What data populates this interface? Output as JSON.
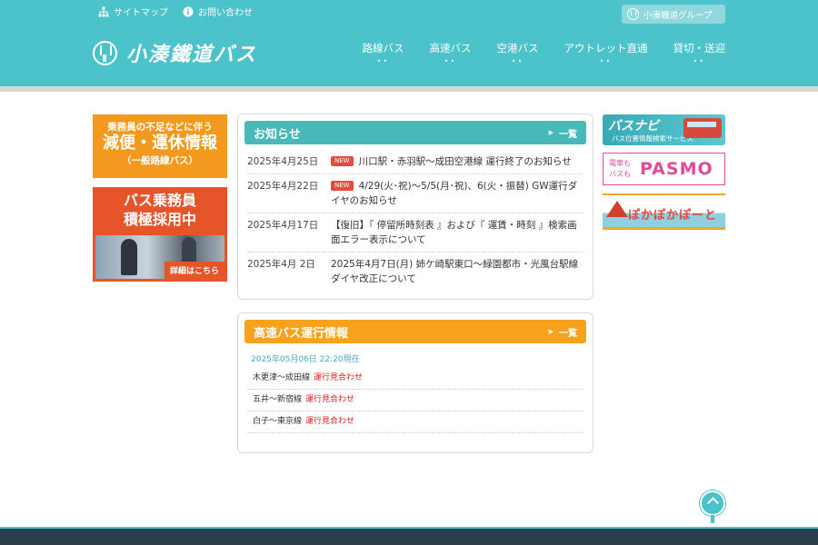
{
  "header": {
    "util_links": [
      {
        "label": "サイトマップ",
        "icon": "sitemap-icon"
      },
      {
        "label": "お問い合わせ",
        "icon": "info-icon"
      }
    ],
    "group_button": "小湊鐵道グループ",
    "logo_text": "小湊鐵道バス",
    "nav": [
      {
        "label": "路線バス"
      },
      {
        "label": "高速バス"
      },
      {
        "label": "空港バス"
      },
      {
        "label": "アウトレット直通"
      },
      {
        "label": "貸切・送迎"
      }
    ]
  },
  "left_banners": {
    "notice": {
      "top": "乗務員の不足などに伴う",
      "main": "減便・運休情報",
      "sub": "（一般路線バス）"
    },
    "recruit": {
      "line1": "バス乗務員",
      "line2": "積極採用中",
      "more": "詳細はこちら"
    }
  },
  "right_banners": {
    "busnavi": {
      "name": "バスナビ",
      "desc": "バス位置情報検索サービス"
    },
    "pasmo": {
      "small1": "電車も",
      "small2": "バスも",
      "big": "PASMO"
    },
    "pokapoka": {
      "text": "ぽかぽかぽーと"
    }
  },
  "news": {
    "title": "お知らせ",
    "more": "一覧",
    "items": [
      {
        "date": "2025年4月25日",
        "new": "NEW",
        "text": "川口駅・赤羽駅〜成田空港線 運行終了のお知らせ"
      },
      {
        "date": "2025年4月22日",
        "new": "NEW",
        "text": "4/29(火･祝)〜5/5(月･祝)、6(火・振替) GW運行ダイヤのお知らせ"
      },
      {
        "date": "2025年4月17日",
        "new": "",
        "text": "【復旧】『 停留所時刻表 』および『 運賃・時刻 』検索画面エラー表示について"
      },
      {
        "date": "2025年4月 2日",
        "new": "",
        "text": "2025年4月7日(月) 姉ケ崎駅東口〜緑園都市・光風台駅線ダイヤ改正について"
      }
    ]
  },
  "highway": {
    "title": "高速バス運行情報",
    "more": "一覧",
    "timestamp": "2025年05月06日 22:20現在",
    "routes": [
      {
        "route": "木更津〜成田線",
        "status": "運行見合わせ"
      },
      {
        "route": "五井〜新宿線",
        "status": "運行見合わせ"
      },
      {
        "route": "白子〜東京線",
        "status": "運行見合わせ"
      }
    ]
  },
  "colors": {
    "header": "#4cc2ca",
    "news_header": "#46b9b8",
    "highway_header": "#f7a21d",
    "status_red": "#d42020",
    "new_badge": "#e64a3c"
  }
}
